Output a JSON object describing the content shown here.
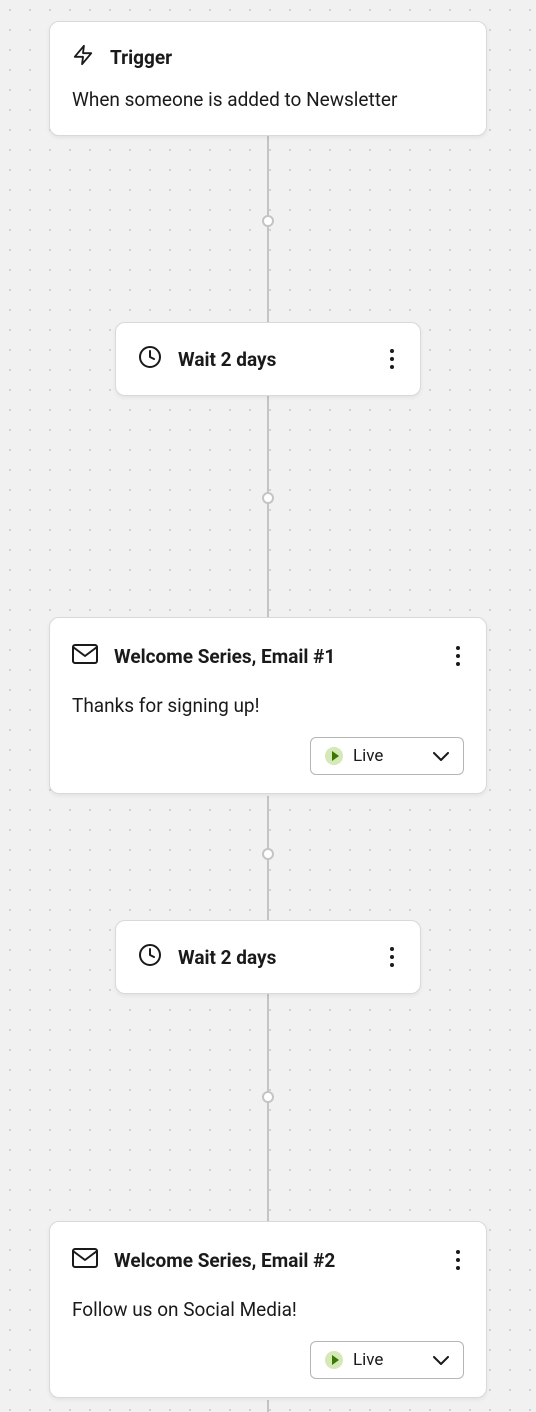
{
  "trigger": {
    "title": "Trigger",
    "description": "When someone is added to Newsletter"
  },
  "steps": [
    {
      "type": "wait",
      "title": "Wait 2 days"
    },
    {
      "type": "email",
      "title": "Welcome Series, Email #1",
      "description": "Thanks for signing up!",
      "status_label": "Live"
    },
    {
      "type": "wait",
      "title": "Wait 2 days"
    },
    {
      "type": "email",
      "title": "Welcome Series, Email #2",
      "description": "Follow us on Social Media!",
      "status_label": "Live"
    }
  ],
  "colors": {
    "live_badge_bg": "#d4e8b8",
    "live_badge_fg": "#3a7800"
  }
}
